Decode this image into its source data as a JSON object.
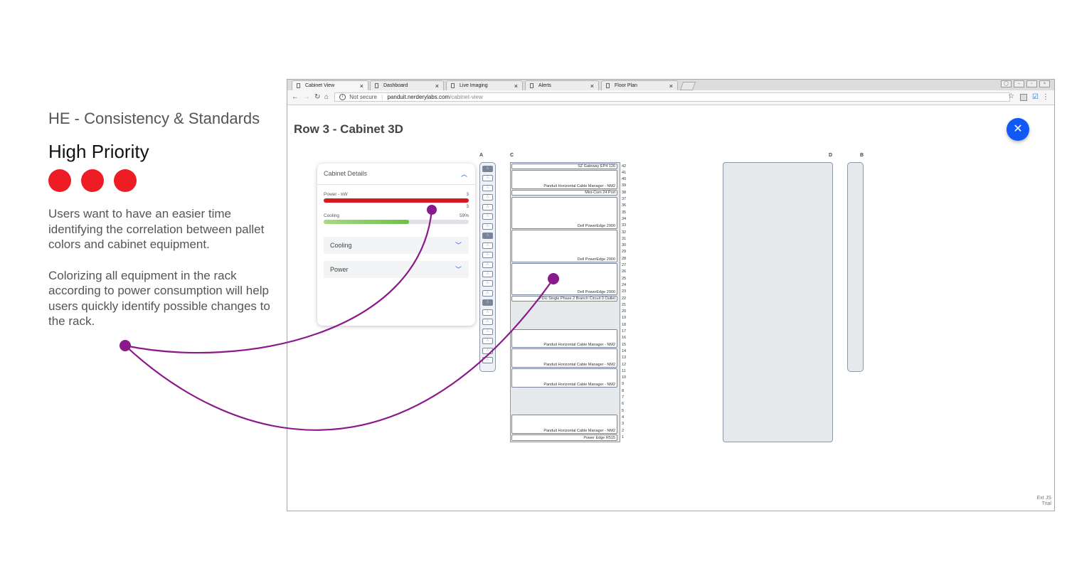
{
  "annotation": {
    "heading": "HE - Consistency & Standards",
    "priority": "High Priority",
    "priority_dot_color": "#ee1c24",
    "paragraph1": "Users want to have an easier time identifying the correlation between pallet colors and cabinet equipment.",
    "paragraph2": "Colorizing all equipment in the rack according to power consumption will help users quickly identify possible changes to the rack.",
    "connector_color": "#8a1a8c"
  },
  "browser": {
    "tabs": [
      {
        "label": "Cabinet View",
        "active": true
      },
      {
        "label": "Dashboard",
        "active": false
      },
      {
        "label": "Live Imaging",
        "active": false
      },
      {
        "label": "Alerts",
        "active": false
      },
      {
        "label": "Floor Plan",
        "active": false
      }
    ],
    "security_label": "Not secure",
    "url_host": "panduit.nerderylabs.com",
    "url_path": "/cabinet-view"
  },
  "page": {
    "title": "Row 3 - Cabinet 3D",
    "close_icon": "close-icon",
    "accent_color": "#1059f5",
    "ext_line1": "Ext JS",
    "ext_line2": "Trial"
  },
  "details": {
    "title": "Cabinet Details",
    "power_label": "Power - kW",
    "power_value": "3",
    "power_value_below": "3",
    "power_fraction": 1.0,
    "power_color": "#d41b20",
    "cooling_label": "Cooling",
    "cooling_value": "59%",
    "cooling_fraction": 0.59,
    "cooling_color": "#6cc04a",
    "sections": [
      {
        "label": "Cooling"
      },
      {
        "label": "Power"
      }
    ]
  },
  "cabinets": {
    "labels": [
      "A",
      "C",
      "D",
      "B"
    ],
    "units": [
      "42",
      "41",
      "40",
      "39",
      "38",
      "37",
      "36",
      "35",
      "34",
      "33",
      "32",
      "31",
      "30",
      "29",
      "28",
      "27",
      "26",
      "25",
      "24",
      "23",
      "22",
      "21",
      "20",
      "19",
      "18",
      "17",
      "16",
      "15",
      "14",
      "13",
      "12",
      "11",
      "10",
      "9",
      "8",
      "7",
      "6",
      "5",
      "4",
      "3",
      "2",
      "1"
    ],
    "devices": [
      {
        "name": "SZ Gateway EP4 126",
        "top_u": 42,
        "height_u": 1
      },
      {
        "name": "Panduit Horizontal Cable Manager - NM2",
        "top_u": 41,
        "height_u": 3
      },
      {
        "name": "Mini-Com 24 Port",
        "top_u": 38,
        "height_u": 1
      },
      {
        "name": "Dell PowerEdge 2900",
        "top_u": 37,
        "height_u": 5
      },
      {
        "name": "Dell PowerEdge 2900",
        "top_u": 32,
        "height_u": 5
      },
      {
        "name": "Dell PowerEdge 2900",
        "top_u": 27,
        "height_u": 5
      },
      {
        "name": "PDU Single Phase 2 Branch Circuit 0 Outlet",
        "top_u": 22,
        "height_u": 1
      },
      {
        "name": "Panduit Horizontal Cable Manager - NM2",
        "top_u": 17,
        "height_u": 3
      },
      {
        "name": "Panduit Horizontal Cable Manager - NM2",
        "top_u": 14,
        "height_u": 3
      },
      {
        "name": "Panduit Horizontal Cable Manager - NM2",
        "top_u": 11,
        "height_u": 3
      },
      {
        "name": "Panduit Horizontal Cable Manager - NM2",
        "top_u": 4,
        "height_u": 3
      },
      {
        "name": "Power Edge R515",
        "top_u": 1,
        "height_u": 1
      }
    ],
    "outlets_total": 21,
    "outlets_on": [
      0,
      7,
      14
    ]
  }
}
